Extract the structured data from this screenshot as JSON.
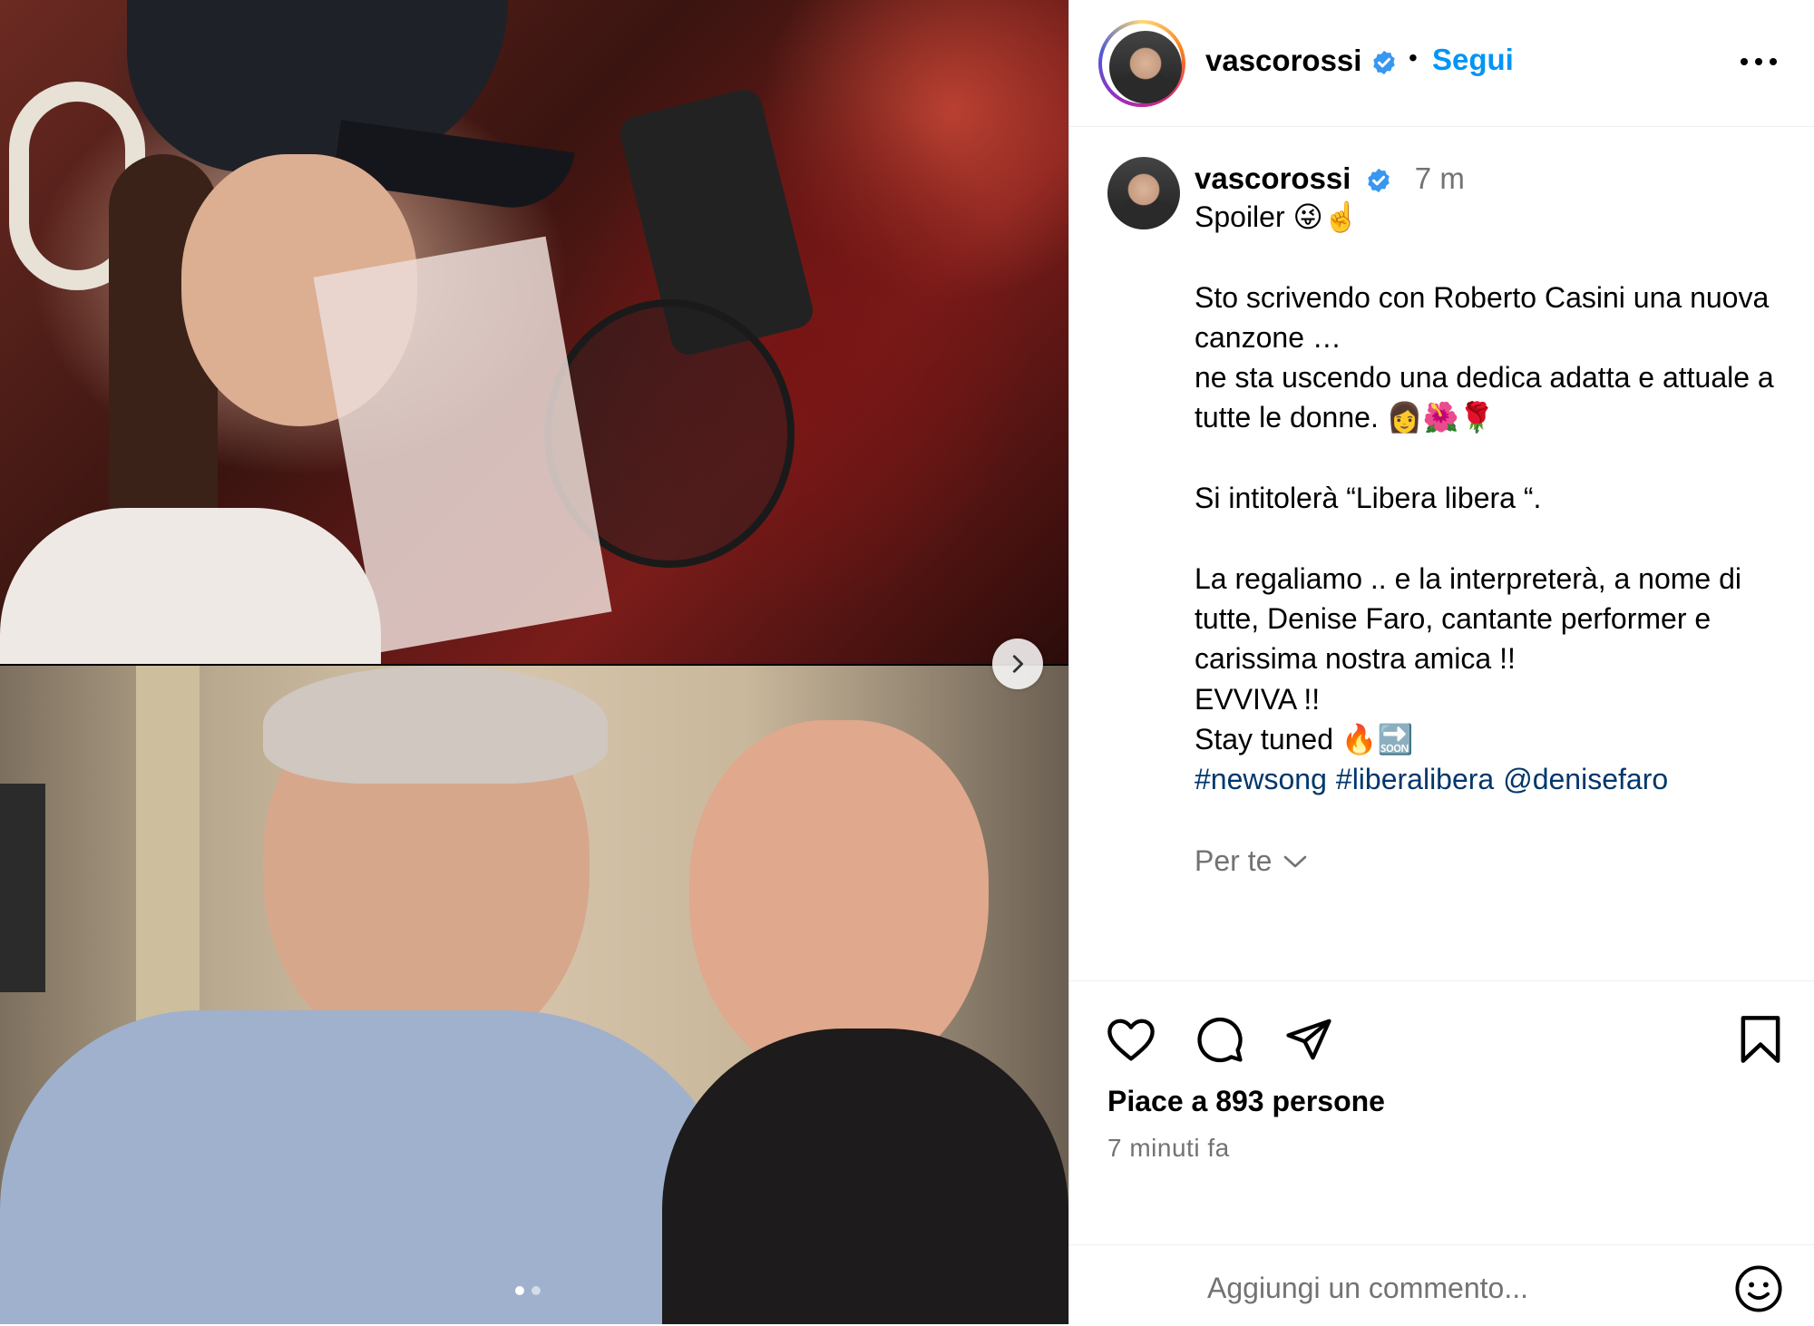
{
  "header": {
    "username": "vascorossi",
    "follow_label": "Segui",
    "separator": "•"
  },
  "post": {
    "username": "vascorossi",
    "time_ago": "7 m",
    "caption": "Spoiler 😜☝️\n\nSto scrivendo con Roberto Casini una nuova canzone …\nne sta uscendo una dedica adatta e attuale a tutte le donne. 👩🌺🌹\n\nSi intitolerà “Libera libera “.\n\nLa regaliamo .. e la interpreterà, a nome di tutte, Denise Faro, cantante performer e carissima nostra amica !!\nEVVIVA !!\nStay tuned 🔥🔜",
    "hashtags": [
      "#newsong",
      "#liberalibera",
      "@denisefaro"
    ],
    "see_translation": "Per te"
  },
  "actions": {
    "likes": "Piace a 893 persone",
    "timestamp": "7 minuti fa"
  },
  "comment": {
    "placeholder": "Aggiungi un commento..."
  },
  "carousel": {
    "current": 1,
    "total": 2
  },
  "icons": {
    "verified": "verified-badge-icon",
    "more": "more-options-icon",
    "like": "heart-icon",
    "comment": "comment-icon",
    "share": "share-icon",
    "save": "bookmark-icon",
    "emoji": "emoji-icon",
    "next": "chevron-right-icon"
  },
  "colors": {
    "link_blue": "#0095f6",
    "hashtag_blue": "#00376b",
    "verified_blue": "#3897f0",
    "secondary_text": "#737373"
  }
}
